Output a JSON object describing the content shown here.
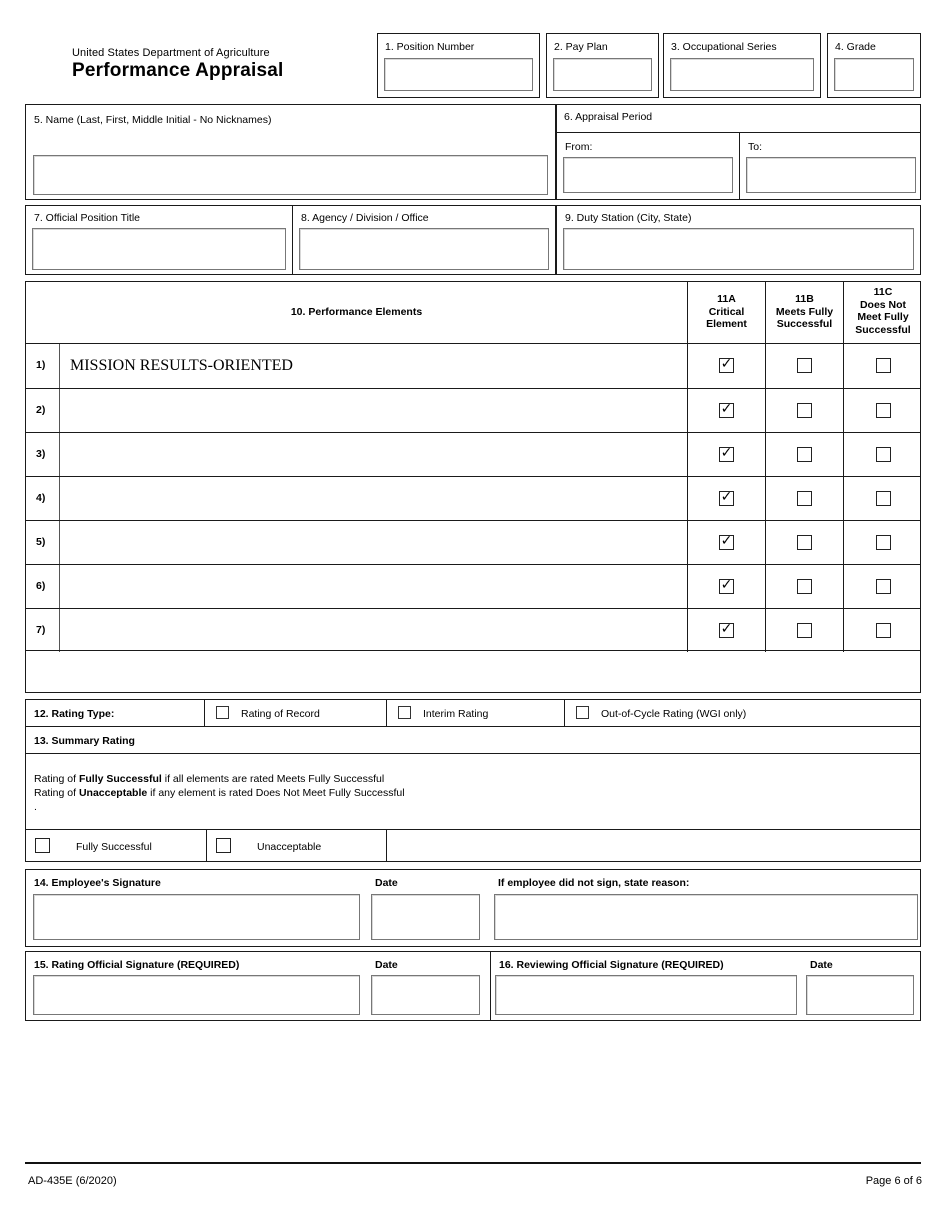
{
  "header": {
    "agency": "United States Department of Agriculture",
    "title": "Performance Appraisal",
    "fields": [
      {
        "label": "1. Position Number",
        "value": ""
      },
      {
        "label": "2. Pay Plan",
        "value": ""
      },
      {
        "label": "3. Occupational Series",
        "value": ""
      },
      {
        "label": "4. Grade",
        "value": ""
      }
    ]
  },
  "identity": {
    "name_label": "5. Name (Last, First, Middle Initial - No Nicknames)",
    "name_value": "",
    "appraisal_period_label": "6. Appraisal Period",
    "from_label": "From:",
    "from_value": "",
    "to_label": "To:",
    "to_value": "",
    "position_title_label": "7. Official Position Title",
    "position_title_value": "",
    "agency_division_label": "8. Agency / Division / Office",
    "agency_division_value": "",
    "duty_station_label": "9. Duty Station (City, State)",
    "duty_station_value": ""
  },
  "elements_table": {
    "title": "10. Performance Elements",
    "columns": [
      {
        "id": "11A",
        "line1": "11A",
        "line2": "Critical",
        "line3": "Element"
      },
      {
        "id": "11B",
        "line1": "11B",
        "line2": "Meets Fully",
        "line3": "Successful"
      },
      {
        "id": "11C",
        "line1": "11C",
        "line2": "Does Not",
        "line3": "Meet Fully",
        "line4": "Successful"
      }
    ],
    "rows": [
      {
        "num": "1)",
        "text": "MISSION RESULTS-ORIENTED",
        "critical": true,
        "meets": false,
        "does_not_meet": false
      },
      {
        "num": "2)",
        "text": "",
        "critical": true,
        "meets": false,
        "does_not_meet": false
      },
      {
        "num": "3)",
        "text": "",
        "critical": true,
        "meets": false,
        "does_not_meet": false
      },
      {
        "num": "4)",
        "text": "",
        "critical": true,
        "meets": false,
        "does_not_meet": false
      },
      {
        "num": "5)",
        "text": "",
        "critical": true,
        "meets": false,
        "does_not_meet": false
      },
      {
        "num": "6)",
        "text": "",
        "critical": true,
        "meets": false,
        "does_not_meet": false
      },
      {
        "num": "7)",
        "text": "",
        "critical": true,
        "meets": false,
        "does_not_meet": false
      }
    ],
    "check_glyph": "✓"
  },
  "rating_type": {
    "label": "12. Rating Type:",
    "options": [
      {
        "label": "Rating of Record",
        "checked": false
      },
      {
        "label": "Interim Rating",
        "checked": false
      },
      {
        "label": "Out-of-Cycle Rating (WGI only)",
        "checked": false
      }
    ]
  },
  "summary_rating": {
    "label": "13. Summary Rating",
    "note_line1_pre": "Rating of ",
    "note_line1_bold": "Fully Successful",
    "note_line1_post": " if all elements are rated Meets Fully Successful",
    "note_line2_pre": "Rating of ",
    "note_line2_bold": "Unacceptable",
    "note_line2_post": " if any element is rated Does Not Meet Fully Successful",
    "note_line3": ".",
    "options": [
      {
        "label": "Fully Successful",
        "checked": false
      },
      {
        "label": "Unacceptable",
        "checked": false
      }
    ]
  },
  "signatures": {
    "employee_label": "14. Employee's Signature",
    "employee_value": "",
    "employee_date_label": "Date",
    "employee_date_value": "",
    "no_sign_reason_label": "If employee did not sign, state reason:",
    "no_sign_reason_value": "",
    "rating_official_label": "15. Rating Official Signature (REQUIRED)",
    "rating_official_value": "",
    "rating_official_date_label": "Date",
    "rating_official_date_value": "",
    "reviewing_official_label": "16. Reviewing Official Signature (REQUIRED)",
    "reviewing_official_value": "",
    "reviewing_official_date_label": "Date",
    "reviewing_official_date_value": ""
  },
  "footer": {
    "form_id": "AD-435E (6/2020)",
    "page": "Page 6 of 6"
  }
}
